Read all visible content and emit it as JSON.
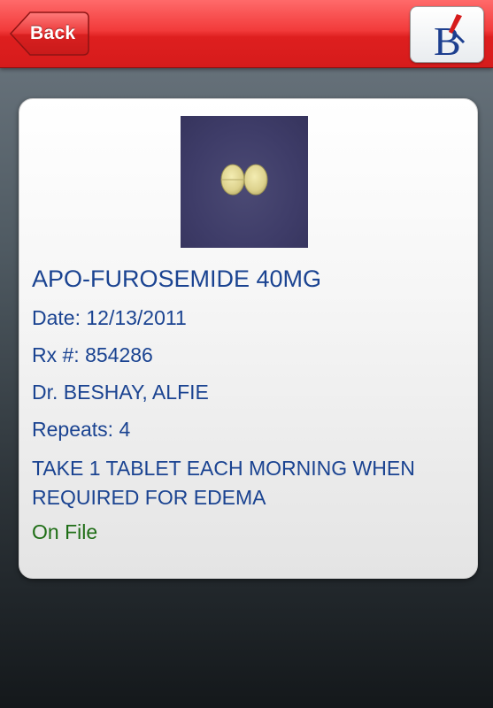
{
  "header": {
    "back_label": "Back",
    "logo_icon": "brand-logo-icon",
    "colors": {
      "bar": "#e52a2a",
      "logo_blue": "#1d3f8f",
      "logo_red": "#d61b1b"
    }
  },
  "prescription": {
    "image_icon": "pill-photo",
    "drug_name": "APO-FUROSEMIDE 40MG",
    "date": "Date: 12/13/2011",
    "rx_number": "Rx #: 854286",
    "doctor": "Dr. BESHAY, ALFIE",
    "repeats": "Repeats: 4",
    "directions": "TAKE 1 TABLET EACH MORNING WHEN REQUIRED FOR EDEMA",
    "status": "On File",
    "colors": {
      "text": "#1a4391",
      "status": "#1f6e16"
    }
  }
}
